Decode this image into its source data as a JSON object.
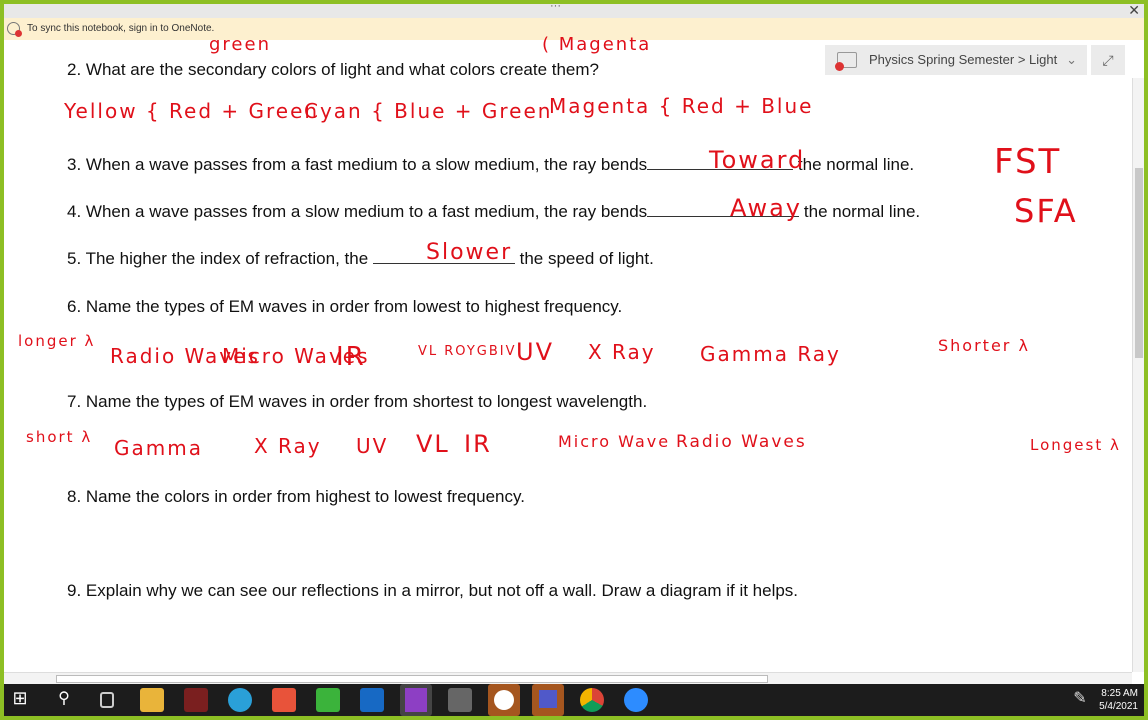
{
  "window": {
    "notice": "To sync this notebook, sign in to OneNote.",
    "breadcrumb": "Physics Spring Semester > Light"
  },
  "questions": [
    "2. What are the secondary colors of light and what colors create them?",
    "3. When a wave passes from a fast medium to a slow medium, the ray bends",
    "the normal line.",
    "4. When a wave passes from a slow medium to a fast medium, the ray bends",
    "the normal line.",
    "5. The higher the index of refraction, the",
    "the speed of light.",
    "6. Name the types of EM waves in order from lowest to highest frequency.",
    "7. Name the types of EM waves in order from shortest to longest wavelength.",
    "8. Name the colors in order from highest to lowest frequency.",
    "9. Explain why we can see our reflections in a mirror, but not off a wall. Draw a diagram if it helps."
  ],
  "handwriting": {
    "top": [
      "green",
      "( Magenta"
    ],
    "q2": [
      "Yellow { Red + Green",
      "Cyan { Blue + Green",
      "Magenta { Red + Blue"
    ],
    "q3": [
      "Toward",
      "FST"
    ],
    "q4": [
      "Away",
      "SFA"
    ],
    "q5": [
      "Slower"
    ],
    "q6": [
      "longer λ",
      "Radio Waves",
      "Micro Waves",
      "IR",
      "VL ROYGBIV",
      "UV",
      "X Ray",
      "Gamma Ray",
      "Shorter λ"
    ],
    "q7": [
      "short λ",
      "Gamma",
      "X Ray",
      "UV",
      "VL",
      "IR",
      "Micro Wave",
      "Radio Waves",
      "Longest λ"
    ]
  },
  "taskbar": {
    "time": "8:25 AM",
    "date": "5/4/2021",
    "apps": [
      "start",
      "search",
      "task-view",
      "file-explorer",
      "app",
      "app",
      "app",
      "app",
      "outlook",
      "onenote",
      "app",
      "webex",
      "teams",
      "chrome",
      "zoom"
    ]
  }
}
